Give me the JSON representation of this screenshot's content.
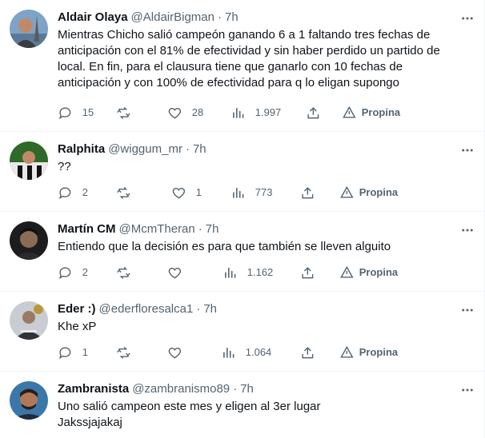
{
  "tweets": [
    {
      "name": "Aldair Olaya",
      "handle": "@AldairBigman",
      "time": "7h",
      "text": "Mientras Chicho salió campeón ganando 6 a 1 faltando tres fechas de\nanticipación con el 81% de efectividad y sin haber perdido un partido de\nlocal. En fin, para el clausura tiene que ganarlo con 10 fechas de\nanticipación y con 100% de efectividad para q lo eligan supongo",
      "replies": "15",
      "retweets": "",
      "likes": "28",
      "views": "1.997",
      "tip": "Propina",
      "avatar_bg": "#6e8fb3",
      "avatar_fg": "#3a3c44"
    },
    {
      "name": "Ralphita",
      "handle": "@wiggum_mr",
      "time": "7h",
      "text": "??",
      "replies": "2",
      "retweets": "",
      "likes": "1",
      "views": "773",
      "tip": "Propina",
      "avatar_bg": "#2f6a2b",
      "avatar_fg": "#e8e8e8"
    },
    {
      "name": "Martín CM",
      "handle": "@McmTheran",
      "time": "7h",
      "text": "Entiendo que la decisión es para que también se lleven alguito",
      "replies": "2",
      "retweets": "",
      "likes": "",
      "views": "1.162",
      "tip": "Propina",
      "avatar_bg": "#1d1d1f",
      "avatar_fg": "#8a6d57"
    },
    {
      "name": "Eder :)",
      "handle": "@ederfloresalca1",
      "time": "7h",
      "text": "Khe xP",
      "replies": "1",
      "retweets": "",
      "likes": "",
      "views": "1.064",
      "tip": "Propina",
      "avatar_bg": "#c9ccd2",
      "avatar_fg": "#303238"
    },
    {
      "name": "Zambranista",
      "handle": "@zambranismo89",
      "time": "7h",
      "text": "Uno salió campeon este mes y eligen al 3er lugar\nJakssjajakaj",
      "replies": "",
      "retweets": "",
      "likes": "",
      "views": "",
      "tip": "",
      "avatar_bg": "#3b77a8",
      "avatar_fg": "#b07a5a"
    }
  ],
  "separator": "·",
  "colors": {
    "text": "#0f1419",
    "secondary": "#536471",
    "border": "#eff3f4"
  }
}
